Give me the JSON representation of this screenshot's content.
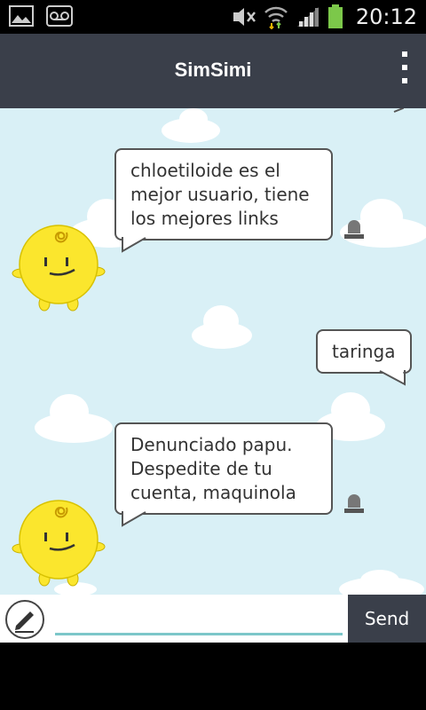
{
  "status_bar": {
    "time": "20:12",
    "icons": [
      "image-icon",
      "voicemail-icon",
      "mute-icon",
      "wifi-icon",
      "signal-icon",
      "battery-icon"
    ]
  },
  "app_bar": {
    "title": "SimSimi",
    "menu_icon": "overflow-menu-icon"
  },
  "messages": [
    {
      "sender": "simsimi",
      "text": "chloetiloide es el mejor usuario, tiene los mejores links"
    },
    {
      "sender": "user",
      "text": "taringa"
    },
    {
      "sender": "simsimi",
      "text": "Denunciado papu. Despedite de tu cuenta, maquinola"
    }
  ],
  "input": {
    "value": "",
    "placeholder": "",
    "send_label": "Send"
  },
  "colors": {
    "app_bar": "#3a3f4a",
    "chat_bg": "#d9f0f6",
    "accent_underline": "#7cc7c9",
    "simsimi_yellow": "#fbe62d"
  }
}
